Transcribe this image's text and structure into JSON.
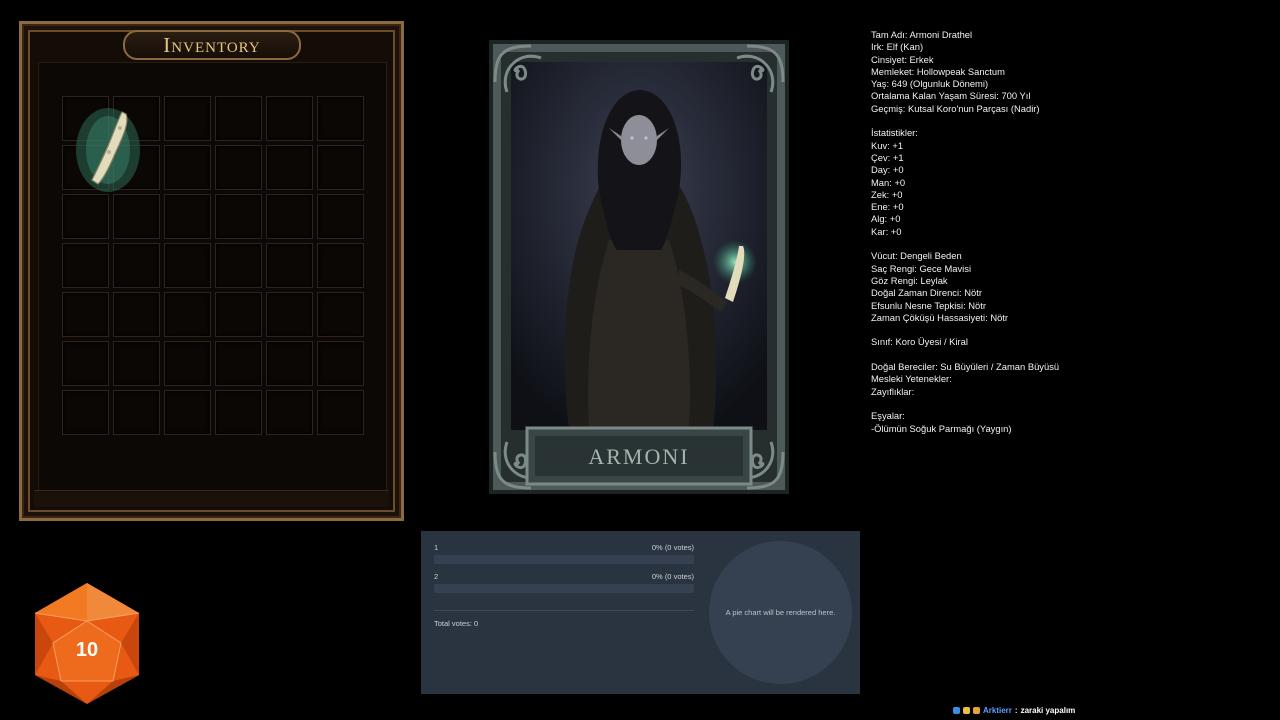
{
  "inventory": {
    "title": "Inventory",
    "slot_count": 42,
    "items": [
      {
        "name": "bone-finger-item"
      }
    ]
  },
  "portrait": {
    "name": "ARMONI",
    "colors": {
      "frame": "#5d6b6a",
      "glow": "#5df0b0"
    }
  },
  "character_sheet": {
    "lines": [
      "Tam Adı: Armoni Drathel",
      "Irk: Elf (Kan)",
      "Cinsiyet: Erkek",
      "Memleket: Hollowpeak Sanctum",
      "Yaş: 649 (Olgunluk Dönemi)",
      "Ortalama Kalan Yaşam Süresi: 700 Yıl",
      "Geçmiş: Kutsal Koro'nun Parçası (Nadir)",
      "",
      "İstatistikler:",
      "Kuv: +1",
      "Çev: +1",
      "Day: +0",
      "Man: +0",
      "Zek: +0",
      "Ene: +0",
      "Alg: +0",
      "Kar: +0",
      "",
      "Vücut: Dengeli Beden",
      "Saç Rengi: Gece Mavisi",
      "Göz Rengi: Leylak",
      "Doğal Zaman Direnci: Nötr",
      "Efsunlu Nesne Tepkisi: Nötr",
      "Zaman Çöküşü Hassasiyeti: Nötr",
      "",
      "Sınıf: Koro Üyesi / Kiral",
      "",
      "Doğal Bereciler: Su Büyüleri / Zaman Büyüsü",
      "Mesleki Yetenekler:",
      "Zayıflıklar:",
      "",
      "Eşyalar:",
      "-Ölümün Soğuk Parmağı (Yaygın)"
    ]
  },
  "poll": {
    "options": [
      {
        "label": "1",
        "result": "0% (0 votes)",
        "fraction": 0
      },
      {
        "label": "2",
        "result": "0% (0 votes)",
        "fraction": 0
      }
    ],
    "total_votes": "Total votes: 0",
    "pie_placeholder": "A pie chart will be rendered here."
  },
  "dice": {
    "value": "10",
    "color": "#e85a14"
  },
  "chat": {
    "username": "Arktierr",
    "separator": ":",
    "message": "zaraki yapalım"
  }
}
